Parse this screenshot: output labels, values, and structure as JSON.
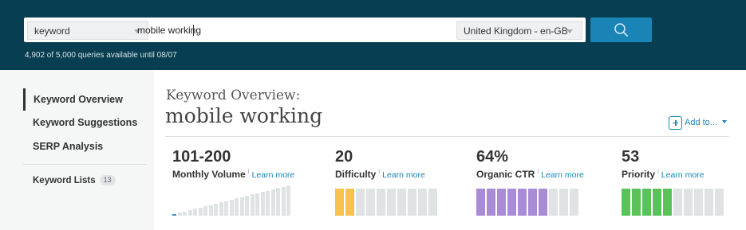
{
  "search": {
    "type_value": "keyword",
    "query_value": "mobile working",
    "locale_value": "United Kingdom - en-GB",
    "button_icon": "search-icon",
    "quota_text": "4,902 of 5,000 queries available until 08/07"
  },
  "sidebar": {
    "items": [
      {
        "label": "Keyword Overview",
        "active": true
      },
      {
        "label": "Keyword Suggestions"
      },
      {
        "label": "SERP Analysis"
      }
    ],
    "lists": {
      "label": "Keyword Lists",
      "count": "13"
    }
  },
  "main": {
    "title_prefix": "Keyword Overview:",
    "title_keyword": "mobile working",
    "add_to_label": "Add to...",
    "add_to_icon": "plus-box-icon"
  },
  "metrics": {
    "volume": {
      "value": "101-200",
      "label": "Monthly Volume",
      "learn": "Learn more",
      "bars_filled": 1,
      "bars_total": 23,
      "color": "#3a8fc6"
    },
    "difficulty": {
      "value": "20",
      "label": "Difficulty",
      "learn": "Learn more",
      "filled": 2,
      "total": 10,
      "color": "#f7c24e"
    },
    "ctr": {
      "value": "64%",
      "label": "Organic CTR",
      "learn": "Learn more",
      "filled": 7,
      "total": 10,
      "color": "#a98bd6"
    },
    "priority": {
      "value": "53",
      "label": "Priority",
      "learn": "Learn more",
      "filled": 5,
      "total": 10,
      "color": "#5bc25a"
    }
  },
  "colors": {
    "header_bg": "#073e52",
    "accent": "#1a84b6"
  }
}
